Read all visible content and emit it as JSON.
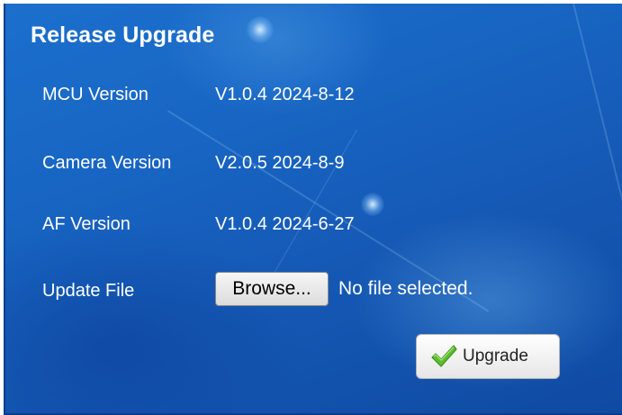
{
  "panel": {
    "title": "Release Upgrade"
  },
  "rows": [
    {
      "label": "MCU Version",
      "value": "V1.0.4 2024-8-12"
    },
    {
      "label": "Camera Version",
      "value": "V2.0.5 2024-8-9"
    },
    {
      "label": "AF Version",
      "value": "V1.0.4 2024-6-27"
    }
  ],
  "update_file": {
    "label": "Update File",
    "browse_label": "Browse...",
    "status": "No file selected."
  },
  "upgrade": {
    "label": "Upgrade",
    "icon": "checkmark-icon"
  },
  "colors": {
    "background": "#1866c4",
    "text": "#ffffff",
    "checkmark": "#4caf2a"
  }
}
